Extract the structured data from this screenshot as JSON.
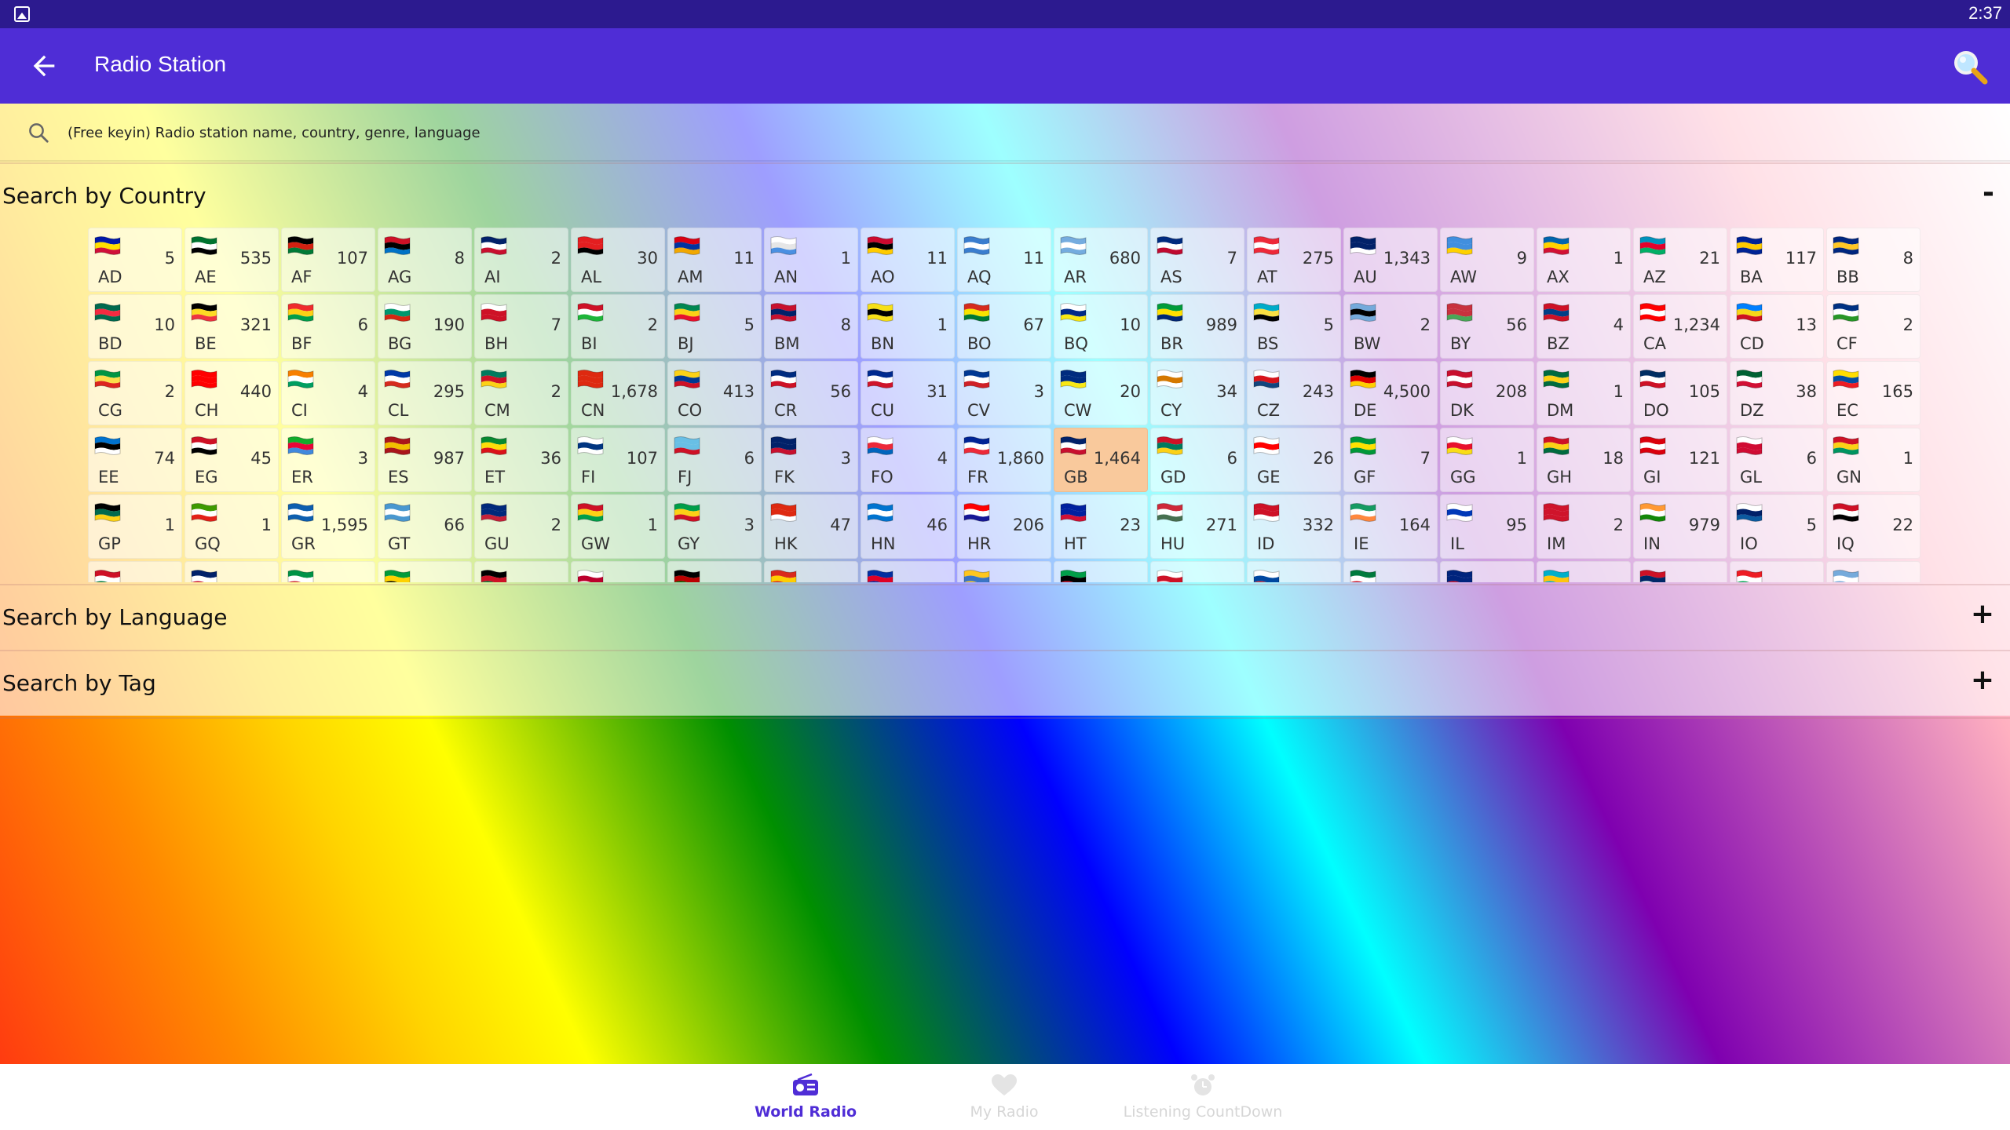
{
  "status_bar": {
    "time": "2:37"
  },
  "app_bar": {
    "title": "Radio Station",
    "back_icon": "arrow-left-icon",
    "search_icon": "magnifier-icon"
  },
  "search": {
    "placeholder": "(Free keyin) Radio station name, country, genre, language",
    "value": ""
  },
  "sections": {
    "country": {
      "title": "Search by Country",
      "toggle": "-"
    },
    "language": {
      "title": "Search by Language",
      "toggle": "+"
    },
    "tag": {
      "title": "Search by Tag",
      "toggle": "+"
    }
  },
  "countries": [
    {
      "code": "AD",
      "count": "5",
      "colors": [
        "#0018a8",
        "#fedf00",
        "#d0103a"
      ]
    },
    {
      "code": "AE",
      "count": "535",
      "colors": [
        "#00732f",
        "#ffffff",
        "#000000"
      ]
    },
    {
      "code": "AF",
      "count": "107",
      "colors": [
        "#000000",
        "#d32011",
        "#007a36"
      ]
    },
    {
      "code": "AG",
      "count": "8",
      "colors": [
        "#ce1126",
        "#000000",
        "#0072c6"
      ]
    },
    {
      "code": "AI",
      "count": "2",
      "colors": [
        "#012169",
        "#ffffff",
        "#c8102e"
      ]
    },
    {
      "code": "AL",
      "count": "30",
      "colors": [
        "#e41e20",
        "#e41e20",
        "#000000"
      ]
    },
    {
      "code": "AM",
      "count": "11",
      "colors": [
        "#d90012",
        "#0033a0",
        "#f2a800"
      ]
    },
    {
      "code": "AN",
      "count": "1",
      "colors": [
        "#ffffff",
        "#e6e6e6",
        "#4a90e2"
      ]
    },
    {
      "code": "AO",
      "count": "11",
      "colors": [
        "#cc092f",
        "#000000",
        "#ffcb00"
      ]
    },
    {
      "code": "AQ",
      "count": "11",
      "colors": [
        "#3a7dce",
        "#ffffff",
        "#3a7dce"
      ]
    },
    {
      "code": "AR",
      "count": "680",
      "colors": [
        "#74acdf",
        "#ffffff",
        "#74acdf"
      ]
    },
    {
      "code": "AS",
      "count": "7",
      "colors": [
        "#002b7f",
        "#ffffff",
        "#bf0a30"
      ]
    },
    {
      "code": "AT",
      "count": "275",
      "colors": [
        "#ed2939",
        "#ffffff",
        "#ed2939"
      ]
    },
    {
      "code": "AU",
      "count": "1,343",
      "colors": [
        "#012169",
        "#012169",
        "#ffffff"
      ]
    },
    {
      "code": "AW",
      "count": "9",
      "colors": [
        "#418fde",
        "#418fde",
        "#ffd100"
      ]
    },
    {
      "code": "AX",
      "count": "1",
      "colors": [
        "#0064ad",
        "#ffd300",
        "#d21034"
      ]
    },
    {
      "code": "AZ",
      "count": "21",
      "colors": [
        "#0092bc",
        "#e4002b",
        "#00af66"
      ]
    },
    {
      "code": "BA",
      "count": "117",
      "colors": [
        "#002395",
        "#fecb00",
        "#002395"
      ]
    },
    {
      "code": "BB",
      "count": "8",
      "colors": [
        "#00267f",
        "#ffc726",
        "#00267f"
      ]
    },
    {
      "code": "BD",
      "count": "10",
      "colors": [
        "#006a4e",
        "#f42a41",
        "#006a4e"
      ]
    },
    {
      "code": "BE",
      "count": "321",
      "colors": [
        "#000000",
        "#fdda24",
        "#ef3340"
      ]
    },
    {
      "code": "BF",
      "count": "6",
      "colors": [
        "#ef2b2d",
        "#fcd116",
        "#009e49"
      ]
    },
    {
      "code": "BG",
      "count": "190",
      "colors": [
        "#ffffff",
        "#00966e",
        "#d62612"
      ]
    },
    {
      "code": "BH",
      "count": "7",
      "colors": [
        "#ffffff",
        "#ce1126",
        "#ce1126"
      ]
    },
    {
      "code": "BI",
      "count": "2",
      "colors": [
        "#ce1126",
        "#ffffff",
        "#1eb53a"
      ]
    },
    {
      "code": "BJ",
      "count": "5",
      "colors": [
        "#008751",
        "#fcd116",
        "#e8112d"
      ]
    },
    {
      "code": "BM",
      "count": "8",
      "colors": [
        "#c8102e",
        "#012169",
        "#c8102e"
      ]
    },
    {
      "code": "BN",
      "count": "1",
      "colors": [
        "#f7e017",
        "#000000",
        "#f7e017"
      ]
    },
    {
      "code": "BO",
      "count": "67",
      "colors": [
        "#d52b1e",
        "#f9e300",
        "#007934"
      ]
    },
    {
      "code": "BQ",
      "count": "10",
      "colors": [
        "#ffffff",
        "#012a87",
        "#f9e814"
      ]
    },
    {
      "code": "BR",
      "count": "989",
      "colors": [
        "#009c3b",
        "#ffdf00",
        "#002776"
      ]
    },
    {
      "code": "BS",
      "count": "5",
      "colors": [
        "#00abc9",
        "#fae042",
        "#000000"
      ]
    },
    {
      "code": "BW",
      "count": "2",
      "colors": [
        "#75aadb",
        "#000000",
        "#75aadb"
      ]
    },
    {
      "code": "BY",
      "count": "56",
      "colors": [
        "#c8313e",
        "#c8313e",
        "#4aa657"
      ]
    },
    {
      "code": "BZ",
      "count": "4",
      "colors": [
        "#ce1126",
        "#003f87",
        "#ce1126"
      ]
    },
    {
      "code": "CA",
      "count": "1,234",
      "colors": [
        "#ff0000",
        "#ffffff",
        "#ff0000"
      ]
    },
    {
      "code": "CD",
      "count": "13",
      "colors": [
        "#007fff",
        "#f7d618",
        "#ce1021"
      ]
    },
    {
      "code": "CF",
      "count": "2",
      "colors": [
        "#003082",
        "#ffffff",
        "#289728"
      ]
    },
    {
      "code": "CG",
      "count": "2",
      "colors": [
        "#009543",
        "#fbde4a",
        "#dc241f"
      ]
    },
    {
      "code": "CH",
      "count": "440",
      "colors": [
        "#ff0000",
        "#ff0000",
        "#ff0000"
      ]
    },
    {
      "code": "CI",
      "count": "4",
      "colors": [
        "#f77f00",
        "#ffffff",
        "#009e60"
      ]
    },
    {
      "code": "CL",
      "count": "295",
      "colors": [
        "#0039a6",
        "#ffffff",
        "#d52b1e"
      ]
    },
    {
      "code": "CM",
      "count": "2",
      "colors": [
        "#007a5e",
        "#ce1126",
        "#fcd116"
      ]
    },
    {
      "code": "CN",
      "count": "1,678",
      "colors": [
        "#de2910",
        "#de2910",
        "#de2910"
      ]
    },
    {
      "code": "CO",
      "count": "413",
      "colors": [
        "#fcd116",
        "#003893",
        "#ce1126"
      ]
    },
    {
      "code": "CR",
      "count": "56",
      "colors": [
        "#002b7f",
        "#ffffff",
        "#ce1126"
      ]
    },
    {
      "code": "CU",
      "count": "31",
      "colors": [
        "#002a8f",
        "#ffffff",
        "#cf142b"
      ]
    },
    {
      "code": "CV",
      "count": "3",
      "colors": [
        "#003893",
        "#ffffff",
        "#cf2027"
      ]
    },
    {
      "code": "CW",
      "count": "20",
      "colors": [
        "#002b7f",
        "#002b7f",
        "#f9e814"
      ]
    },
    {
      "code": "CY",
      "count": "34",
      "colors": [
        "#ffffff",
        "#d57800",
        "#ffffff"
      ]
    },
    {
      "code": "CZ",
      "count": "243",
      "colors": [
        "#ffffff",
        "#d7141a",
        "#11457e"
      ]
    },
    {
      "code": "DE",
      "count": "4,500",
      "colors": [
        "#000000",
        "#dd0000",
        "#ffce00"
      ]
    },
    {
      "code": "DK",
      "count": "208",
      "colors": [
        "#c8102e",
        "#ffffff",
        "#c8102e"
      ]
    },
    {
      "code": "DM",
      "count": "1",
      "colors": [
        "#006b3f",
        "#fcd116",
        "#006b3f"
      ]
    },
    {
      "code": "DO",
      "count": "105",
      "colors": [
        "#002d62",
        "#ffffff",
        "#ce1126"
      ]
    },
    {
      "code": "DZ",
      "count": "38",
      "colors": [
        "#006233",
        "#ffffff",
        "#d21034"
      ]
    },
    {
      "code": "EC",
      "count": "165",
      "colors": [
        "#ffdd00",
        "#034ea2",
        "#ed1c24"
      ]
    },
    {
      "code": "EE",
      "count": "74",
      "colors": [
        "#0072ce",
        "#000000",
        "#ffffff"
      ]
    },
    {
      "code": "EG",
      "count": "45",
      "colors": [
        "#ce1126",
        "#ffffff",
        "#000000"
      ]
    },
    {
      "code": "ER",
      "count": "3",
      "colors": [
        "#12ad2b",
        "#ea0437",
        "#4189dd"
      ]
    },
    {
      "code": "ES",
      "count": "987",
      "colors": [
        "#aa151b",
        "#f1bf00",
        "#aa151b"
      ]
    },
    {
      "code": "ET",
      "count": "36",
      "colors": [
        "#078930",
        "#fcdd09",
        "#da121a"
      ]
    },
    {
      "code": "FI",
      "count": "107",
      "colors": [
        "#ffffff",
        "#003580",
        "#ffffff"
      ]
    },
    {
      "code": "FJ",
      "count": "6",
      "colors": [
        "#68bfe5",
        "#68bfe5",
        "#ce1126"
      ]
    },
    {
      "code": "FK",
      "count": "3",
      "colors": [
        "#012169",
        "#012169",
        "#c8102e"
      ]
    },
    {
      "code": "FO",
      "count": "4",
      "colors": [
        "#ffffff",
        "#ed2939",
        "#0065bd"
      ]
    },
    {
      "code": "FR",
      "count": "1,860",
      "colors": [
        "#002395",
        "#ffffff",
        "#ed2939"
      ]
    },
    {
      "code": "GB",
      "count": "1,464",
      "colors": [
        "#012169",
        "#ffffff",
        "#c8102e"
      ],
      "selected": true
    },
    {
      "code": "GD",
      "count": "6",
      "colors": [
        "#ce1126",
        "#007a5e",
        "#fcd116"
      ]
    },
    {
      "code": "GE",
      "count": "26",
      "colors": [
        "#ffffff",
        "#ff0000",
        "#ffffff"
      ]
    },
    {
      "code": "GF",
      "count": "7",
      "colors": [
        "#009739",
        "#ffe100",
        "#009739"
      ]
    },
    {
      "code": "GG",
      "count": "1",
      "colors": [
        "#ffffff",
        "#e8112d",
        "#f9dd16"
      ]
    },
    {
      "code": "GH",
      "count": "18",
      "colors": [
        "#ce1126",
        "#fcd116",
        "#006b3f"
      ]
    },
    {
      "code": "GI",
      "count": "121",
      "colors": [
        "#da000c",
        "#ffffff",
        "#da000c"
      ]
    },
    {
      "code": "GL",
      "count": "6",
      "colors": [
        "#ffffff",
        "#d00c33",
        "#d00c33"
      ]
    },
    {
      "code": "GN",
      "count": "1",
      "colors": [
        "#ce1126",
        "#fcd116",
        "#009460"
      ]
    },
    {
      "code": "GP",
      "count": "1",
      "colors": [
        "#000000",
        "#006a4e",
        "#fcd116"
      ]
    },
    {
      "code": "GQ",
      "count": "1",
      "colors": [
        "#3e9a00",
        "#ffffff",
        "#e32118"
      ]
    },
    {
      "code": "GR",
      "count": "1,595",
      "colors": [
        "#0d5eaf",
        "#ffffff",
        "#0d5eaf"
      ]
    },
    {
      "code": "GT",
      "count": "66",
      "colors": [
        "#4997d0",
        "#ffffff",
        "#4997d0"
      ]
    },
    {
      "code": "GU",
      "count": "2",
      "colors": [
        "#00297b",
        "#00297b",
        "#c62139"
      ]
    },
    {
      "code": "GW",
      "count": "1",
      "colors": [
        "#ce1126",
        "#fcd116",
        "#009e49"
      ]
    },
    {
      "code": "GY",
      "count": "3",
      "colors": [
        "#009e49",
        "#fcd116",
        "#ce1126"
      ]
    },
    {
      "code": "HK",
      "count": "47",
      "colors": [
        "#de2910",
        "#de2910",
        "#ffffff"
      ]
    },
    {
      "code": "HN",
      "count": "46",
      "colors": [
        "#0073cf",
        "#ffffff",
        "#0073cf"
      ]
    },
    {
      "code": "HR",
      "count": "206",
      "colors": [
        "#ff0000",
        "#ffffff",
        "#171796"
      ]
    },
    {
      "code": "HT",
      "count": "23",
      "colors": [
        "#00209f",
        "#00209f",
        "#d21034"
      ]
    },
    {
      "code": "HU",
      "count": "271",
      "colors": [
        "#ce2939",
        "#ffffff",
        "#477050"
      ]
    },
    {
      "code": "ID",
      "count": "332",
      "colors": [
        "#ce1126",
        "#ce1126",
        "#ffffff"
      ]
    },
    {
      "code": "IE",
      "count": "164",
      "colors": [
        "#169b62",
        "#ffffff",
        "#ff883e"
      ]
    },
    {
      "code": "IL",
      "count": "95",
      "colors": [
        "#ffffff",
        "#0038b8",
        "#ffffff"
      ]
    },
    {
      "code": "IM",
      "count": "2",
      "colors": [
        "#cf142b",
        "#cf142b",
        "#cf142b"
      ]
    },
    {
      "code": "IN",
      "count": "979",
      "colors": [
        "#ff9933",
        "#ffffff",
        "#138808"
      ]
    },
    {
      "code": "IO",
      "count": "5",
      "colors": [
        "#ffffff",
        "#012169",
        "#0b5aa0"
      ]
    },
    {
      "code": "IQ",
      "count": "22",
      "colors": [
        "#ce1126",
        "#ffffff",
        "#000000"
      ]
    },
    {
      "code": "",
      "count": "",
      "colors": [
        "#ce1126",
        "#ffffff",
        "#007a3d"
      ]
    },
    {
      "code": "",
      "count": "",
      "colors": [
        "#012169",
        "#ffffff",
        "#c8102e"
      ]
    },
    {
      "code": "",
      "count": "",
      "colors": [
        "#009246",
        "#ffffff",
        "#ce2b37"
      ]
    },
    {
      "code": "",
      "count": "",
      "colors": [
        "#009b3a",
        "#fed100",
        "#000000"
      ]
    },
    {
      "code": "",
      "count": "",
      "colors": [
        "#000000",
        "#ce1126",
        "#007a3d"
      ]
    },
    {
      "code": "",
      "count": "",
      "colors": [
        "#ffffff",
        "#bc002d",
        "#ffffff"
      ]
    },
    {
      "code": "",
      "count": "",
      "colors": [
        "#000000",
        "#bb0000",
        "#006600"
      ]
    },
    {
      "code": "",
      "count": "",
      "colors": [
        "#da291c",
        "#ffcd00",
        "#da291c"
      ]
    },
    {
      "code": "",
      "count": "",
      "colors": [
        "#032ea1",
        "#e00025",
        "#032ea1"
      ]
    },
    {
      "code": "",
      "count": "",
      "colors": [
        "#ffc61e",
        "#3a75c4",
        "#ffc61e"
      ]
    },
    {
      "code": "",
      "count": "",
      "colors": [
        "#009e49",
        "#000000",
        "#ce1126"
      ]
    },
    {
      "code": "",
      "count": "",
      "colors": [
        "#ffffff",
        "#ce1126",
        "#ffffff"
      ]
    },
    {
      "code": "",
      "count": "",
      "colors": [
        "#ffffff",
        "#0047a0",
        "#cd2e3a"
      ]
    },
    {
      "code": "",
      "count": "",
      "colors": [
        "#007a3d",
        "#ffffff",
        "#ce1126"
      ]
    },
    {
      "code": "",
      "count": "",
      "colors": [
        "#00247d",
        "#00247d",
        "#cf142b"
      ]
    },
    {
      "code": "",
      "count": "",
      "colors": [
        "#00afca",
        "#fec50c",
        "#00afca"
      ]
    },
    {
      "code": "",
      "count": "",
      "colors": [
        "#ce1126",
        "#002868",
        "#ffffff"
      ]
    },
    {
      "code": "",
      "count": "",
      "colors": [
        "#ed1c24",
        "#ffffff",
        "#00a651"
      ]
    },
    {
      "code": "",
      "count": "",
      "colors": [
        "#75aadb",
        "#ffffff",
        "#75aadb"
      ]
    }
  ],
  "bottom_nav": {
    "world_radio": {
      "label": "World Radio",
      "icon": "radio-icon"
    },
    "my_radio": {
      "label": "My Radio",
      "icon": "heart-icon"
    },
    "listening_countdown": {
      "label": "Listening CountDown",
      "icon": "alarm-clock-icon"
    }
  },
  "colors": {
    "status_bar": "#2c1a8f",
    "app_bar": "#4f2dd6",
    "selected_cell": "#f9c99c",
    "nav_active": "#4f2dd6"
  }
}
